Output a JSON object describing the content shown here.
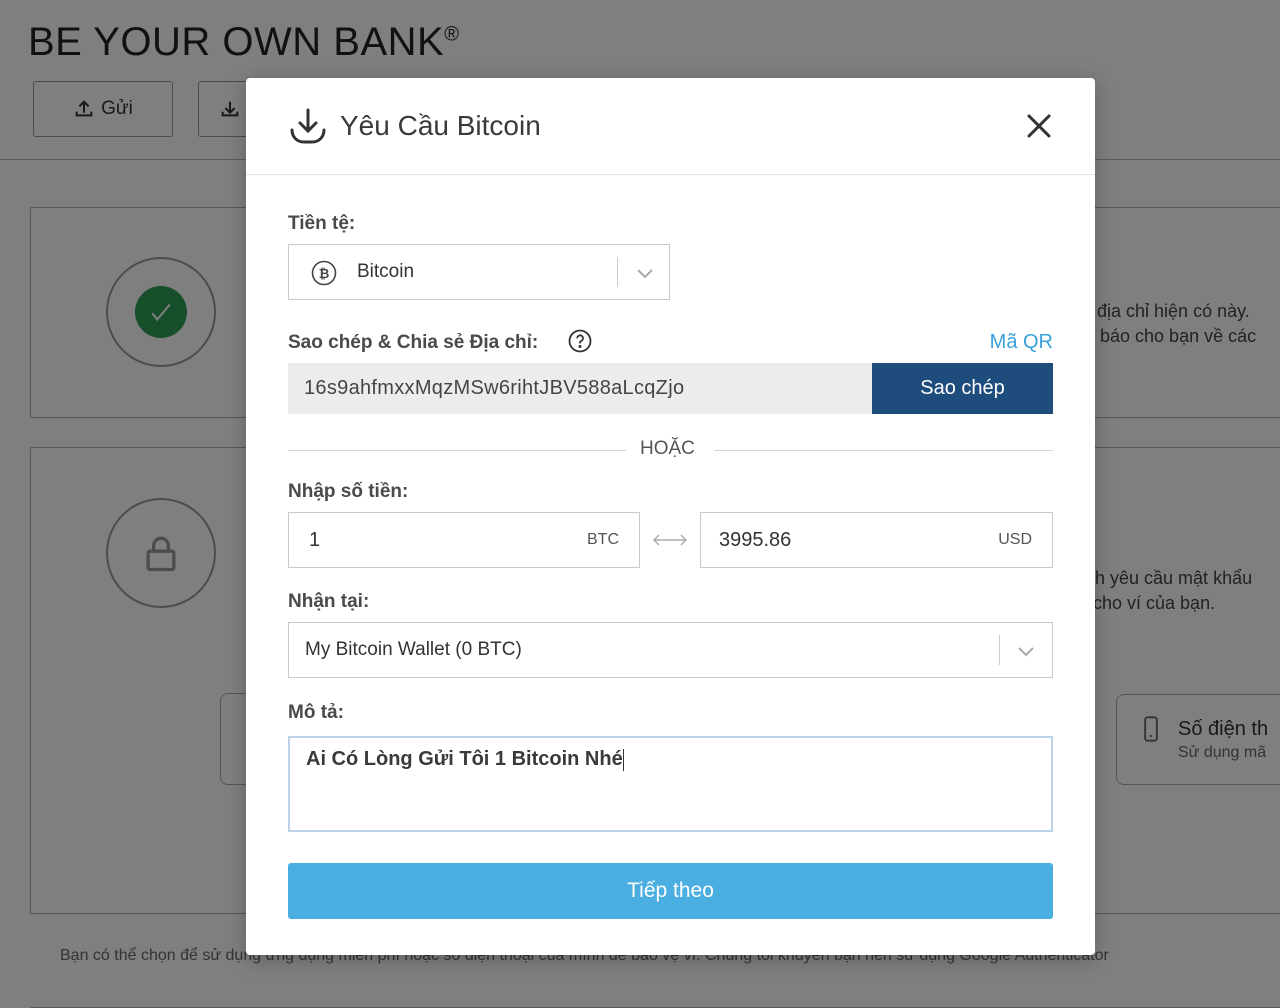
{
  "background": {
    "title": "BE YOUR OWN BANK",
    "title_mark": "®",
    "send_button": "Gửi",
    "text_line1": "địa chỉ hiện có này.",
    "text_line2": "báo cho bạn về các",
    "text_line3": "h yêu cầu mật khẩu",
    "text_line4": "cho ví của bạn.",
    "phone_title": "Số điện th",
    "phone_sub": "Sử dụng mã",
    "footer_text": "Bạn có thể chọn để sử dụng ứng dụng miễn phí hoặc số điện thoại của mình để bảo vệ ví. Chúng tôi khuyên bạn nên sử dụng Google Authenticator"
  },
  "modal": {
    "title": "Yêu Cầu Bitcoin",
    "currency_label": "Tiền tệ:",
    "currency_value": "Bitcoin",
    "address_label": "Sao chép & Chia sẻ Địa chỉ:",
    "qr_link": "Mã QR",
    "address_value": "16s9ahfmxxMqzMSw6rihtJBV588aLcqZjo",
    "copy_button": "Sao chép",
    "or_text": "HOẶC",
    "amount_label": "Nhập số tiền:",
    "amount_btc": "1",
    "unit_btc": "BTC",
    "amount_usd": "3995.86",
    "unit_usd": "USD",
    "receive_label": "Nhận tại:",
    "receive_value": "My Bitcoin Wallet (0 BTC)",
    "description_label": "Mô tả:",
    "description_value": "Ai Có Lòng Gửi Tôi 1 Bitcoin Nhé",
    "next_button": "Tiếp theo"
  },
  "colors": {
    "copy_button_bg": "#1d4c7d",
    "next_button_bg": "#4aaee0",
    "qr_link": "#3aa0dc",
    "check_green": "#2c9e55"
  }
}
